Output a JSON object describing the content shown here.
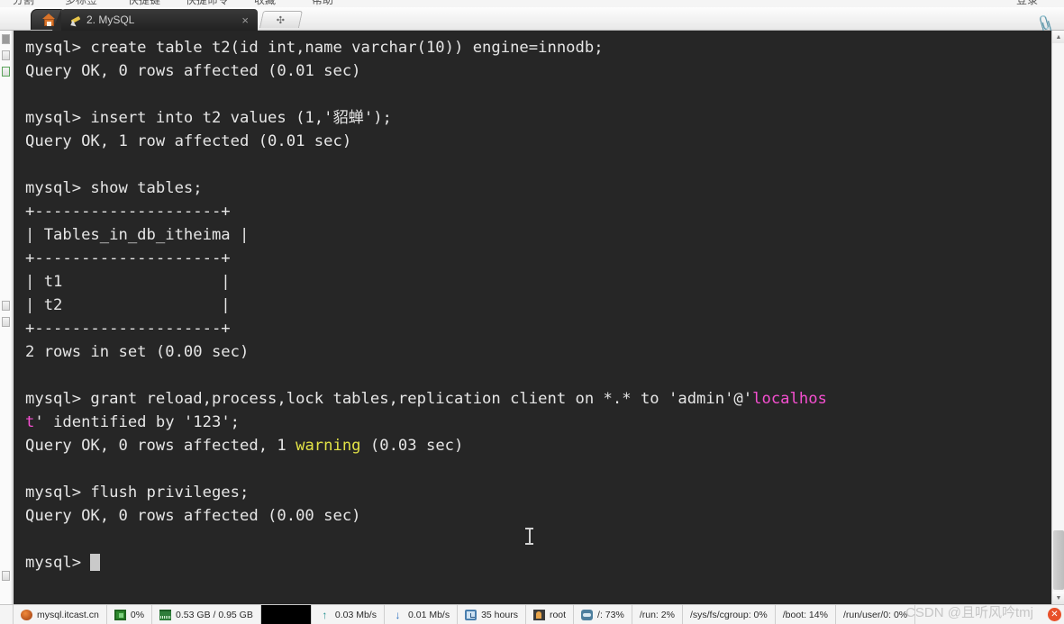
{
  "menubar": {
    "items": [
      "分割",
      "多标签",
      "快捷键",
      "快捷命令",
      "收藏",
      "帮助"
    ],
    "right_item": "登录"
  },
  "tabbar": {
    "home_icon": "home-icon",
    "tab_icon": "wrench-icon",
    "tab_label": "2. MySQL",
    "close_glyph": "×",
    "new_tab_glyph": "✣",
    "clip_icon_glyph": "📎"
  },
  "terminal": {
    "lines": [
      {
        "segments": [
          {
            "text": "mysql> create table t2(id int,name varchar(10)) engine=innodb;",
            "color": "default"
          }
        ]
      },
      {
        "segments": [
          {
            "text": "Query OK, 0 rows affected (0.01 sec)",
            "color": "default"
          }
        ]
      },
      {
        "segments": [
          {
            "text": "",
            "color": "default"
          }
        ]
      },
      {
        "segments": [
          {
            "text": "mysql> insert into t2 values (1,'貂蝉');",
            "color": "default"
          }
        ]
      },
      {
        "segments": [
          {
            "text": "Query OK, 1 row affected (0.01 sec)",
            "color": "default"
          }
        ]
      },
      {
        "segments": [
          {
            "text": "",
            "color": "default"
          }
        ]
      },
      {
        "segments": [
          {
            "text": "mysql> show tables;",
            "color": "default"
          }
        ]
      },
      {
        "segments": [
          {
            "text": "+--------------------+",
            "color": "default"
          }
        ]
      },
      {
        "segments": [
          {
            "text": "| Tables_in_db_itheima |",
            "color": "default"
          }
        ]
      },
      {
        "segments": [
          {
            "text": "+--------------------+",
            "color": "default"
          }
        ]
      },
      {
        "segments": [
          {
            "text": "| t1                 |",
            "color": "default"
          }
        ]
      },
      {
        "segments": [
          {
            "text": "| t2                 |",
            "color": "default"
          }
        ]
      },
      {
        "segments": [
          {
            "text": "+--------------------+",
            "color": "default"
          }
        ]
      },
      {
        "segments": [
          {
            "text": "2 rows in set (0.00 sec)",
            "color": "default"
          }
        ]
      },
      {
        "segments": [
          {
            "text": "",
            "color": "default"
          }
        ]
      },
      {
        "segments": [
          {
            "text": "mysql> grant reload,process,lock tables,replication client on *.* to 'admin'@'",
            "color": "default"
          },
          {
            "text": "localhos",
            "color": "magenta"
          }
        ]
      },
      {
        "segments": [
          {
            "text": "t",
            "color": "magenta"
          },
          {
            "text": "' identified by '123';",
            "color": "default"
          }
        ]
      },
      {
        "segments": [
          {
            "text": "Query OK, 0 rows affected, 1 ",
            "color": "default"
          },
          {
            "text": "warning",
            "color": "yellow"
          },
          {
            "text": " (0.03 sec)",
            "color": "default"
          }
        ]
      },
      {
        "segments": [
          {
            "text": "",
            "color": "default"
          }
        ]
      },
      {
        "segments": [
          {
            "text": "mysql> flush privileges;",
            "color": "default"
          }
        ]
      },
      {
        "segments": [
          {
            "text": "Query OK, 0 rows affected (0.00 sec)",
            "color": "default"
          }
        ]
      },
      {
        "segments": [
          {
            "text": "",
            "color": "default"
          }
        ]
      },
      {
        "segments": [
          {
            "text": "mysql> ",
            "color": "default",
            "cursor": true
          }
        ]
      }
    ],
    "colors": {
      "background": "#262626",
      "foreground": "#e6e6e6",
      "magenta": "#f54fd0",
      "yellow": "#e2e246"
    }
  },
  "scrollbar": {
    "up_glyph": "▲",
    "down_glyph": "▼"
  },
  "statusbar": {
    "cells": [
      {
        "icon": "host-icon",
        "label": "mysql.itcast.cn"
      },
      {
        "icon": "cpu-icon",
        "label": "0%"
      },
      {
        "icon": "ram-icon",
        "label": "0.53 GB / 0.95 GB"
      },
      {
        "icon": "upload-icon",
        "label": "0.03 Mb/s"
      },
      {
        "icon": "download-icon",
        "label": "0.01 Mb/s"
      },
      {
        "icon": "uptime-icon",
        "label": "35 hours"
      },
      {
        "icon": "user-icon",
        "label": "root"
      },
      {
        "icon": "disk-icon",
        "label": "/: 73%"
      }
    ],
    "plain_cells": [
      "/run: 2%",
      "/sys/fs/cgroup: 0%",
      "/boot: 14%",
      "/run/user/0: 0%"
    ],
    "watermark": "CSDN @且听风吟tmj",
    "close_badge_glyph": "✕"
  }
}
